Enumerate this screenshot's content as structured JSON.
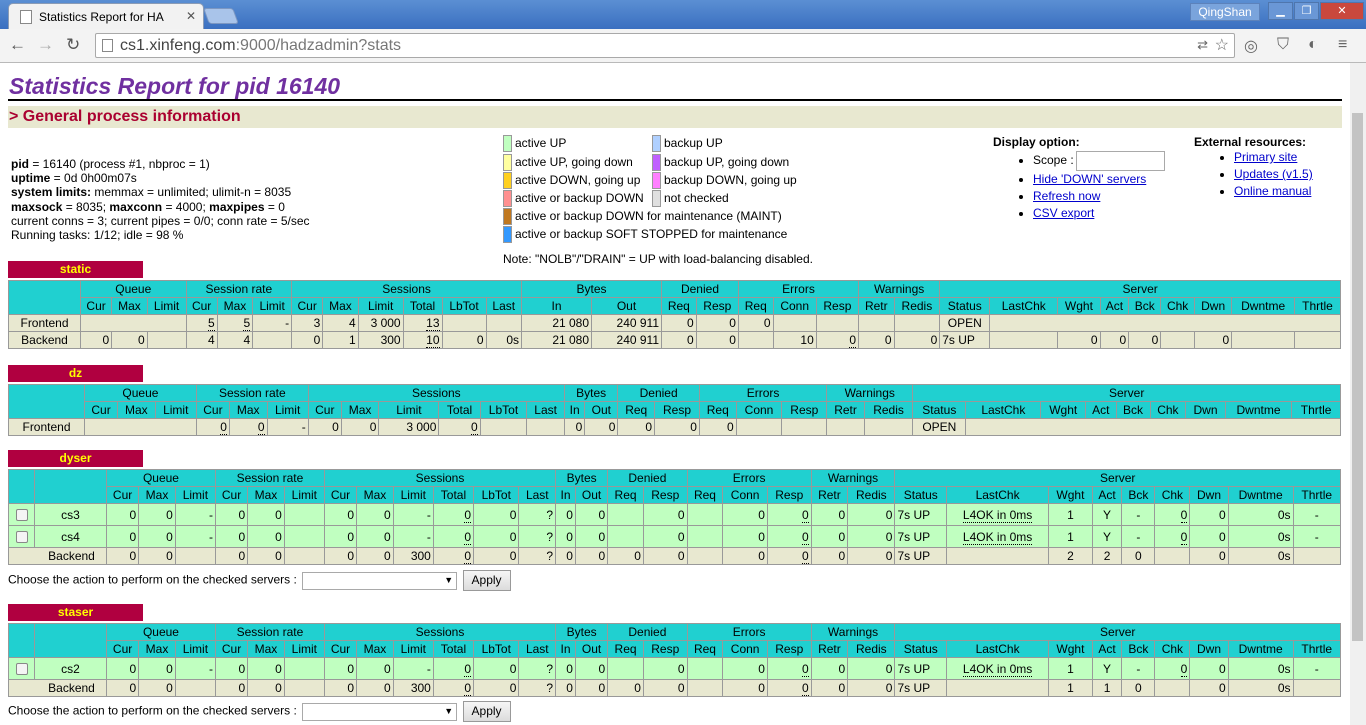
{
  "browser": {
    "tab_title": "Statistics Report for HA",
    "user": "QingShan",
    "url_host": "cs1.xinfeng.com",
    "url_path": ":9000/hadzadmin?stats"
  },
  "page": {
    "title": "Statistics Report for pid 16140",
    "section_title": "> General process information",
    "proc_info": [
      {
        "label": "pid",
        "text": " = 16140 (process #1, nbproc = 1)"
      },
      {
        "label": "uptime",
        "text": " = 0d 0h00m07s"
      },
      {
        "label": "system limits:",
        "text": " memmax = unlimited; ulimit-n = 8035"
      },
      {
        "label": "maxsock",
        "text": " = 8035; ",
        "label2": "maxconn",
        "text2": " = 4000; ",
        "label3": "maxpipes",
        "text3": " = 0"
      },
      {
        "label": "",
        "text": "current conns = 3; current pipes = 0/0; conn rate = 5/sec"
      },
      {
        "label": "",
        "text": "Running tasks: 1/12; idle = 98 %"
      }
    ],
    "legend": {
      "active_up": "active UP",
      "backup_up": "backup UP",
      "active_going_down": "active UP, going down",
      "backup_going_down": "backup UP, going down",
      "active_going_up": "active DOWN, going up",
      "backup_going_up": "backup DOWN, going up",
      "any_down": "active or backup DOWN",
      "not_checked": "not checked",
      "maint": "active or backup DOWN for maintenance (MAINT)",
      "soft_stopped": "active or backup SOFT STOPPED for maintenance",
      "note": "Note: \"NOLB\"/\"DRAIN\" = UP with load-balancing disabled.",
      "colors": {
        "active_up": "#c0ffc0",
        "backup_up": "#b0d0ff",
        "active_going_down": "#ffffa0",
        "backup_going_down": "#c060ff",
        "active_going_up": "#ffd020",
        "backup_going_up": "#ff80ff",
        "any_down": "#ff9090",
        "not_checked": "#e0e0e0",
        "maint": "#c07820",
        "soft_stopped": "#3399ff"
      }
    },
    "display_option": {
      "title": "Display option:",
      "scope_label": "Scope :",
      "hide_down": "Hide 'DOWN' servers",
      "refresh": "Refresh now",
      "csv": "CSV export"
    },
    "external": {
      "title": "External resources:",
      "primary": "Primary site",
      "updates": "Updates (v1.5)",
      "manual": "Online manual"
    },
    "actions": {
      "label": "Choose the action to perform on the checked servers :",
      "apply": "Apply"
    },
    "headers": {
      "queue": "Queue",
      "session_rate": "Session rate",
      "sessions": "Sessions",
      "bytes": "Bytes",
      "denied": "Denied",
      "errors": "Errors",
      "warnings": "Warnings",
      "server": "Server",
      "cur": "Cur",
      "max": "Max",
      "limit": "Limit",
      "total": "Total",
      "lbtot": "LbTot",
      "last": "Last",
      "in": "In",
      "out": "Out",
      "req": "Req",
      "resp": "Resp",
      "conn": "Conn",
      "retr": "Retr",
      "redis": "Redis",
      "status": "Status",
      "lastchk": "LastChk",
      "wght": "Wght",
      "act": "Act",
      "bck": "Bck",
      "chk": "Chk",
      "dwn": "Dwn",
      "dwntme": "Dwntme",
      "thrtle": "Thrtle"
    },
    "proxies": [
      {
        "name": "static"
      },
      {
        "name": "dz"
      },
      {
        "name": "dyser"
      },
      {
        "name": "staser"
      }
    ]
  },
  "tables": {
    "static": {
      "frontend": {
        "name": "Frontend",
        "s_cur": "5",
        "s_max": "5",
        "s_lim": "-",
        "se_cur": "3",
        "se_max": "4",
        "se_lim": "3 000",
        "se_tot": "13",
        "in": "21 080",
        "out": "240 911",
        "d_req": "0",
        "d_resp": "0",
        "e_req": "0",
        "status": "OPEN"
      },
      "backend": {
        "name": "Backend",
        "q_cur": "0",
        "q_max": "0",
        "s_cur": "4",
        "s_max": "4",
        "se_cur": "0",
        "se_max": "1",
        "se_lim": "300",
        "se_tot": "10",
        "lbtot": "0",
        "last": "0s",
        "in": "21 080",
        "out": "240 911",
        "d_req": "0",
        "d_resp": "0",
        "e_conn": "10",
        "e_resp": "0",
        "w_retr": "0",
        "w_redis": "0",
        "status": "7s UP",
        "wght": "0",
        "act": "0",
        "bck": "0",
        "dwn": "0"
      }
    },
    "dz": {
      "frontend": {
        "name": "Frontend",
        "s_cur": "0",
        "s_max": "0",
        "s_lim": "-",
        "se_cur": "0",
        "se_max": "0",
        "se_lim": "3 000",
        "se_tot": "0",
        "in": "0",
        "out": "0",
        "d_req": "0",
        "d_resp": "0",
        "e_req": "0",
        "status": "OPEN"
      }
    },
    "dyser": {
      "servers": [
        {
          "name": "cs3",
          "q_cur": "0",
          "q_max": "0",
          "q_lim": "-",
          "s_cur": "0",
          "s_max": "0",
          "se_cur": "0",
          "se_max": "0",
          "se_lim": "-",
          "se_tot": "0",
          "lbtot": "0",
          "last": "?",
          "in": "0",
          "out": "0",
          "d_resp": "0",
          "e_conn": "0",
          "e_resp": "0",
          "w_retr": "0",
          "w_redis": "0",
          "status": "7s UP",
          "lastchk": "L4OK in 0ms",
          "wght": "1",
          "act": "Y",
          "bck": "-",
          "chk": "0",
          "dwn": "0",
          "dwntme": "0s",
          "thrtle": "-"
        },
        {
          "name": "cs4",
          "q_cur": "0",
          "q_max": "0",
          "q_lim": "-",
          "s_cur": "0",
          "s_max": "0",
          "se_cur": "0",
          "se_max": "0",
          "se_lim": "-",
          "se_tot": "0",
          "lbtot": "0",
          "last": "?",
          "in": "0",
          "out": "0",
          "d_resp": "0",
          "e_conn": "0",
          "e_resp": "0",
          "w_retr": "0",
          "w_redis": "0",
          "status": "7s UP",
          "lastchk": "L4OK in 0ms",
          "wght": "1",
          "act": "Y",
          "bck": "-",
          "chk": "0",
          "dwn": "0",
          "dwntme": "0s",
          "thrtle": "-"
        }
      ],
      "backend": {
        "name": "Backend",
        "q_cur": "0",
        "q_max": "0",
        "s_cur": "0",
        "s_max": "0",
        "se_cur": "0",
        "se_max": "0",
        "se_lim": "300",
        "se_tot": "0",
        "lbtot": "0",
        "last": "?",
        "in": "0",
        "out": "0",
        "d_req": "0",
        "d_resp": "0",
        "e_conn": "0",
        "e_resp": "0",
        "w_retr": "0",
        "w_redis": "0",
        "status": "7s UP",
        "wght": "2",
        "act": "2",
        "bck": "0",
        "dwn": "0",
        "dwntme": "0s"
      }
    },
    "staser": {
      "servers": [
        {
          "name": "cs2",
          "q_cur": "0",
          "q_max": "0",
          "q_lim": "-",
          "s_cur": "0",
          "s_max": "0",
          "se_cur": "0",
          "se_max": "0",
          "se_lim": "-",
          "se_tot": "0",
          "lbtot": "0",
          "last": "?",
          "in": "0",
          "out": "0",
          "d_resp": "0",
          "e_conn": "0",
          "e_resp": "0",
          "w_retr": "0",
          "w_redis": "0",
          "status": "7s UP",
          "lastchk": "L4OK in 0ms",
          "wght": "1",
          "act": "Y",
          "bck": "-",
          "chk": "0",
          "dwn": "0",
          "dwntme": "0s",
          "thrtle": "-"
        }
      ],
      "backend": {
        "name": "Backend",
        "q_cur": "0",
        "q_max": "0",
        "s_cur": "0",
        "s_max": "0",
        "se_cur": "0",
        "se_max": "0",
        "se_lim": "300",
        "se_tot": "0",
        "lbtot": "0",
        "last": "?",
        "in": "0",
        "out": "0",
        "d_req": "0",
        "d_resp": "0",
        "e_conn": "0",
        "e_resp": "0",
        "w_retr": "0",
        "w_redis": "0",
        "status": "7s UP",
        "wght": "1",
        "act": "1",
        "bck": "0",
        "dwn": "0",
        "dwntme": "0s"
      }
    }
  }
}
